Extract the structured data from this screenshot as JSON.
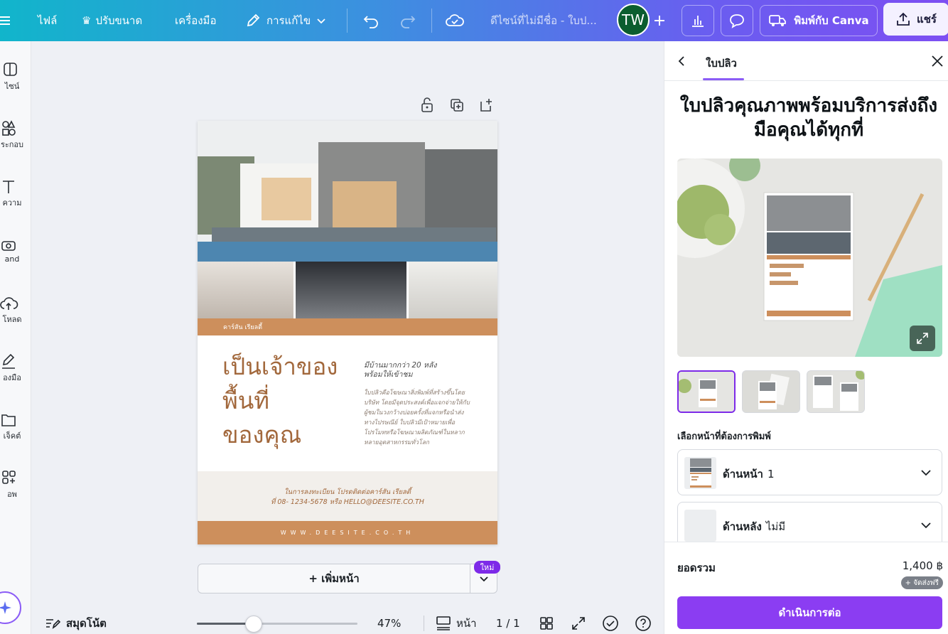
{
  "toolbar": {
    "file": "ไฟล์",
    "resize": "ปรับขนาด",
    "tools": "เครื่องมือ",
    "editing": "การแก้ไข",
    "doc_title": "ดีไซน์ที่ไม่มีชื่อ - ใบป...",
    "avatar_initials": "TW",
    "print_label": "พิมพ์กับ Canva",
    "share_label": "แชร์"
  },
  "rail": {
    "items": [
      {
        "label": "ไซน์",
        "icon": "layout-icon"
      },
      {
        "label": "ระกอบ",
        "icon": "elements-icon"
      },
      {
        "label": "ความ",
        "icon": "text-icon"
      },
      {
        "label": "and",
        "icon": "brand-icon"
      },
      {
        "label": "โหลด",
        "icon": "upload-icon"
      },
      {
        "label": "องมือ",
        "icon": "draw-icon"
      },
      {
        "label": "เจ็คต์",
        "icon": "folder-icon"
      },
      {
        "label": "อพ",
        "icon": "apps-icon"
      }
    ]
  },
  "flyer": {
    "brand": "คาร์สัน เรียลตี้",
    "title_lines": [
      "เป็นเจ้าของ",
      "พื้นที่",
      "ของคุณ"
    ],
    "subtitle_lines": [
      "มีบ้านมากกว่า 20 หลัง",
      "พร้อมให้เข้าชม"
    ],
    "body": "ใบปลิวคือโฆษณาสิ่งพิมพ์ที่สร้างขึ้นโดยบริษัท โดยมีจุดประสงค์เพื่อแจกจ่ายให้กับผู้ชมในวงกว้างบ่อยครั้งที่แจกหรือนำส่งทางไปรษณีย์ ใบปลิวมีเป้าหมายเพื่อโปรโมทหรือโฆษณาผลิตภัณฑ์ในหลากหลายอุตสาหกรรมทั่วโลก",
    "contact_line1": "ในการลงทะเบียน โปรดติดต่อคาร์สัน เรียลตี้",
    "contact_line2": "ที่ 08- 1234-5678 หรือ HELLO@DEESITE.CO.TH",
    "website": "WWW.DEESITE.CO.TH"
  },
  "canvas": {
    "add_page": "+ เพิ่มหน้า",
    "new_badge": "ใหม่"
  },
  "bottombar": {
    "notes": "สมุดโน้ต",
    "zoom": "47%",
    "zoom_fraction": 0.47,
    "pages_label": "หน้า",
    "page_count": "1 / 1"
  },
  "panel": {
    "tab": "ใบปลิว",
    "title": "ใบปลิวคุณภาพพร้อมบริการส่งถึงมือคุณได้ทุกที่",
    "select_label": "เลือกหน้าที่ต้องการพิมพ์",
    "front_label": "ด้านหน้า",
    "front_value": "1",
    "back_label": "ด้านหลัง",
    "back_value": "ไม่มี",
    "total_label": "ยอดรวม",
    "total_value": "1,400 ฿",
    "shipping": "+ จัดส่งฟรี",
    "continue": "ดำเนินการต่อ"
  },
  "colors": {
    "accent": "#8b3df2",
    "flyer_brown": "#cd8f5c",
    "flyer_text": "#a2683c"
  }
}
